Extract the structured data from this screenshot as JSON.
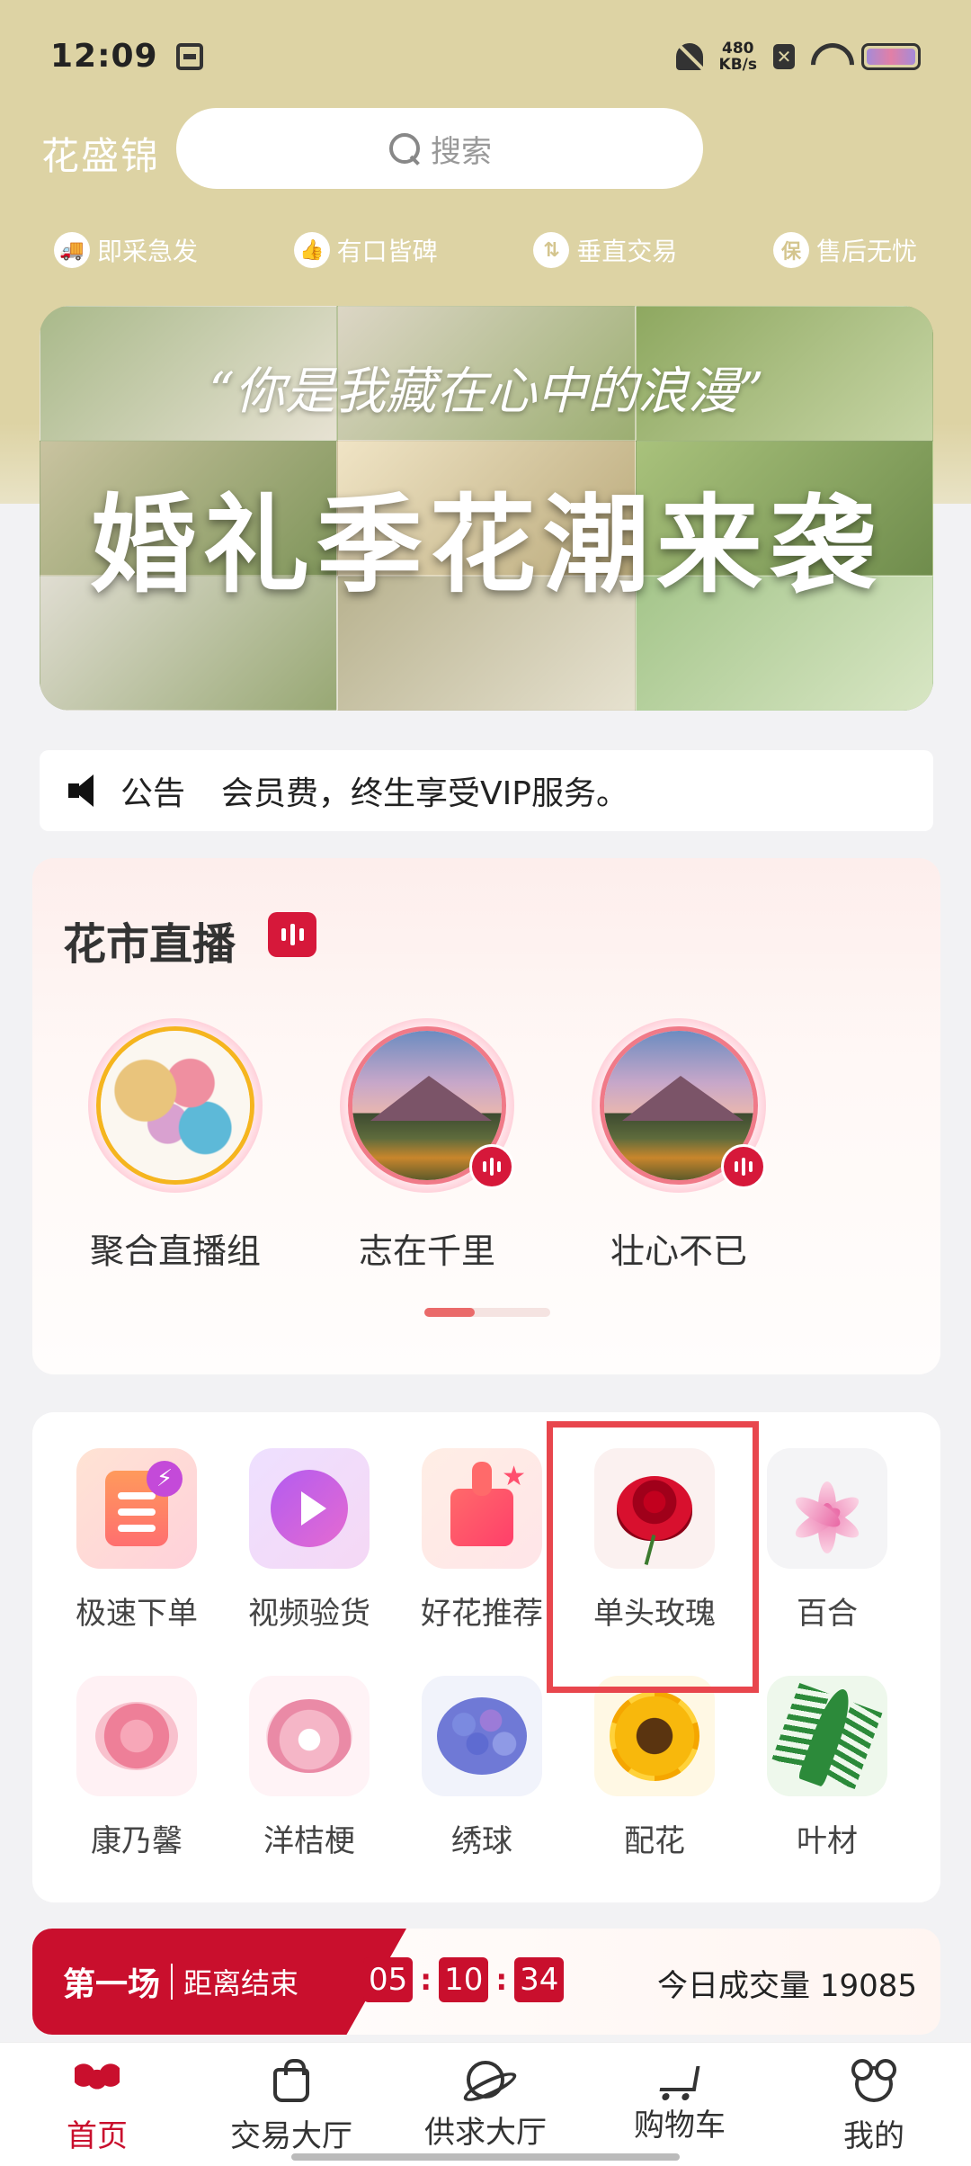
{
  "status_bar": {
    "time": "12:09",
    "net_speed_value": "480",
    "net_speed_unit": "KB/s"
  },
  "header": {
    "brand": "花盛锦",
    "search_placeholder": "搜索"
  },
  "features": [
    {
      "icon": "truck-icon",
      "glyph": "🚚",
      "label": "即采急发"
    },
    {
      "icon": "trophy-icon",
      "glyph": "👍",
      "label": "有口皆碑"
    },
    {
      "icon": "vertical-arrows-icon",
      "glyph": "⇅",
      "label": "垂直交易"
    },
    {
      "icon": "shield-icon",
      "glyph": "保",
      "label": "售后无忧"
    }
  ],
  "banner": {
    "subtitle": "“你是我藏在心中的浪漫”",
    "title": "婚礼季花潮来袭"
  },
  "notice": {
    "label": "公告",
    "text": "会员费，终生享受VIP服务。"
  },
  "live": {
    "title": "花市直播",
    "items": [
      {
        "name": "聚合直播组"
      },
      {
        "name": "志在千里"
      },
      {
        "name": "壮心不已"
      }
    ],
    "page_indicator": {
      "pages": 2,
      "current": 1
    }
  },
  "categories": [
    {
      "label": "极速下单",
      "icon": "quick-order-icon"
    },
    {
      "label": "视频验货",
      "icon": "video-play-icon"
    },
    {
      "label": "好花推荐",
      "icon": "thumbs-up-icon"
    },
    {
      "label": "单头玫瑰",
      "icon": "rose-icon"
    },
    {
      "label": "百合",
      "icon": "lily-icon"
    },
    {
      "label": "康乃馨",
      "icon": "carnation-icon"
    },
    {
      "label": "洋桔梗",
      "icon": "eustoma-icon"
    },
    {
      "label": "绣球",
      "icon": "hydrangea-icon"
    },
    {
      "label": "配花",
      "icon": "sunflower-icon"
    },
    {
      "label": "叶材",
      "icon": "fern-icon"
    }
  ],
  "auction": {
    "round": "第一场",
    "ends_label": "距离结束",
    "countdown": {
      "h": "05",
      "m": "10",
      "s": "34"
    },
    "volume_text": "今日成交量 19085"
  },
  "nav": [
    {
      "label": "首页",
      "icon": "home-flower-icon",
      "active": true
    },
    {
      "label": "交易大厅",
      "icon": "shopping-bag-icon",
      "active": false
    },
    {
      "label": "供求大厅",
      "icon": "planet-icon",
      "active": false
    },
    {
      "label": "购物车",
      "icon": "cart-icon",
      "active": false
    },
    {
      "label": "我的",
      "icon": "bear-profile-icon",
      "active": false
    }
  ],
  "colors": {
    "header_bg": "#ddd3a4",
    "accent_red": "#c90f2d",
    "highlight_box": "#e8464d"
  }
}
